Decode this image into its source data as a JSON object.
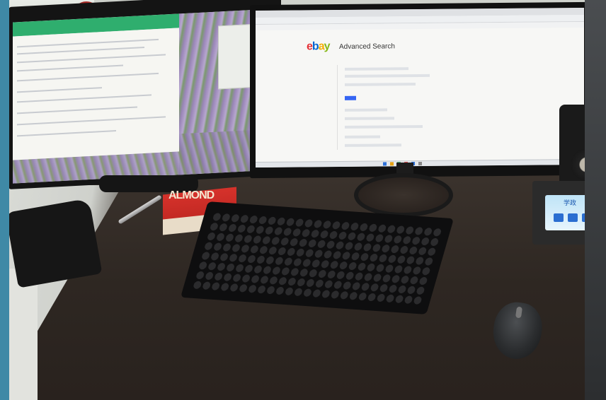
{
  "photo": {
    "description_type": "photograph",
    "screens": {
      "left": {
        "app_color": "#2fae6e"
      },
      "right": {
        "ebay_logo": {
          "e": "e",
          "b": "b",
          "a": "a",
          "y": "y"
        },
        "page_heading": "Advanced Search"
      }
    },
    "snack_label": "ALMOND",
    "device_label": "学政"
  }
}
